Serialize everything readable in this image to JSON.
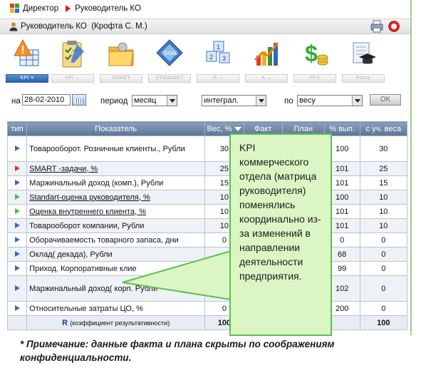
{
  "breadcrumb": {
    "root": "Директор",
    "current": "Руководитель КО"
  },
  "user": {
    "label": "Руководитель КО  (Крофта С. М.)"
  },
  "modules": [
    {
      "label": "KPI",
      "active": true
    },
    {
      "label": "KPI",
      "active": false
    },
    {
      "label": "SMART",
      "active": false
    },
    {
      "label": "STANDART",
      "active": false
    },
    {
      "label": "R",
      "active": false
    },
    {
      "label": "K",
      "active": false
    },
    {
      "label": "PFX",
      "active": false
    },
    {
      "label": "Policy",
      "active": false
    }
  ],
  "filters": {
    "date_prefix": "на",
    "date_value": "28-02-2010",
    "period_label": "период",
    "period_value": "месяц",
    "mode_value": "интеграл.",
    "by_label": "по",
    "by_value": "весу",
    "ok_label": "OK"
  },
  "table": {
    "headers": {
      "type": "тип",
      "indicator": "Показатель",
      "weight": "Вес, %",
      "fact": "Факт",
      "plan": "План",
      "pct": "% вып.",
      "weighted": "с уч. веса"
    },
    "rows": [
      {
        "type": "blue",
        "name": "Товарооборот. Розничные клиенты., Рубли",
        "link": false,
        "weight": "30",
        "pct": "100",
        "weighted": "30"
      },
      {
        "type": "red",
        "name": "SMART -задачи, %",
        "link": true,
        "weight": "25",
        "pct": "101",
        "weighted": "25"
      },
      {
        "type": "blue",
        "name": "Маржинальный доход (комп.), Рубли",
        "link": false,
        "weight": "15",
        "pct": "101",
        "weighted": "15"
      },
      {
        "type": "green",
        "name": "Standart-оценка руководителя, %",
        "link": true,
        "weight": "10",
        "pct": "100",
        "weighted": "10"
      },
      {
        "type": "green",
        "name": "Оценка внутреннего клиента, %",
        "link": true,
        "weight": "10",
        "pct": "101",
        "weighted": "10"
      },
      {
        "type": "blue",
        "name": "Товарооборот компании, Рубли",
        "link": false,
        "weight": "10",
        "pct": "101",
        "weighted": "10"
      },
      {
        "type": "blue",
        "name": "Оборачиваемость товарного запаса, дни",
        "link": false,
        "weight": "0",
        "pct": "0",
        "weighted": "0"
      },
      {
        "type": "blue",
        "name": "Оклад( декада), Рубли",
        "link": false,
        "weight": "",
        "pct": "68",
        "weighted": "0"
      },
      {
        "type": "blue",
        "name": "Приход. Корпоративные клие",
        "link": false,
        "weight": "",
        "pct": "99",
        "weighted": "0"
      },
      {
        "type": "blue",
        "name": "Маржинальный доход( корп. Рубли",
        "link": false,
        "weight": "",
        "pct": "102",
        "weighted": "0"
      },
      {
        "type": "blue",
        "name": "Относительные затраты ЦО, %",
        "link": false,
        "weight": "0",
        "pct": "200",
        "weighted": "0"
      }
    ],
    "total": {
      "label": "R",
      "note": "(коэффициент результативности)",
      "weight": "100",
      "weighted": "100"
    }
  },
  "callout": {
    "text": "KPI коммерческого отдела (матрица руководителя) поменялись координально из-за изменений в направлении деятельности предприятия."
  },
  "footnote": "* Примечание: данные факта и плана скрыты по соображениям конфиденциальности."
}
